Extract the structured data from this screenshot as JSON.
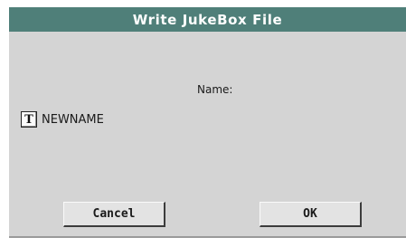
{
  "dialog": {
    "title": "Write JukeBox File",
    "name_label": "Name:",
    "name_value": "NEWNAME",
    "text_edit_icon_glyph": "T",
    "icon": "text-edit-icon"
  },
  "buttons": {
    "cancel_label": "Cancel",
    "ok_label": "OK"
  },
  "colors": {
    "titlebar": "#4f7f79",
    "dialog_background": "#d4d4d4"
  }
}
